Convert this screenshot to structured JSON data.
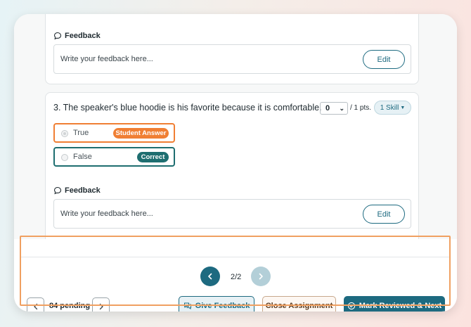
{
  "feedback_block_1": {
    "heading": "Feedback",
    "placeholder": "Write your feedback here...",
    "edit_label": "Edit"
  },
  "question": {
    "title": "3.  The speaker's blue hoodie is his favorite because it is comfortable.",
    "points_value": "0",
    "points_suffix": "/ 1 pts.",
    "skill_label": "1 Skill",
    "options": [
      {
        "label": "True",
        "badge": "Student Answer",
        "badge_color": "#f07f34"
      },
      {
        "label": "False",
        "badge": "Correct",
        "badge_color": "#1e6e70"
      }
    ]
  },
  "feedback_block_2": {
    "heading": "Feedback",
    "placeholder": "Write your feedback here...",
    "edit_label": "Edit"
  },
  "footer": {
    "page_count": "2/2",
    "pending_label": "84 pending",
    "give_feedback_label": "Give Feedback",
    "close_assignment_label": "Close Assignment",
    "mark_reviewed_label": "Mark Reviewed & Next"
  },
  "colors": {
    "accent": "#1d6a80",
    "student_answer": "#f07f34",
    "correct": "#1e6e70",
    "highlight_outline": "#f0a061"
  }
}
